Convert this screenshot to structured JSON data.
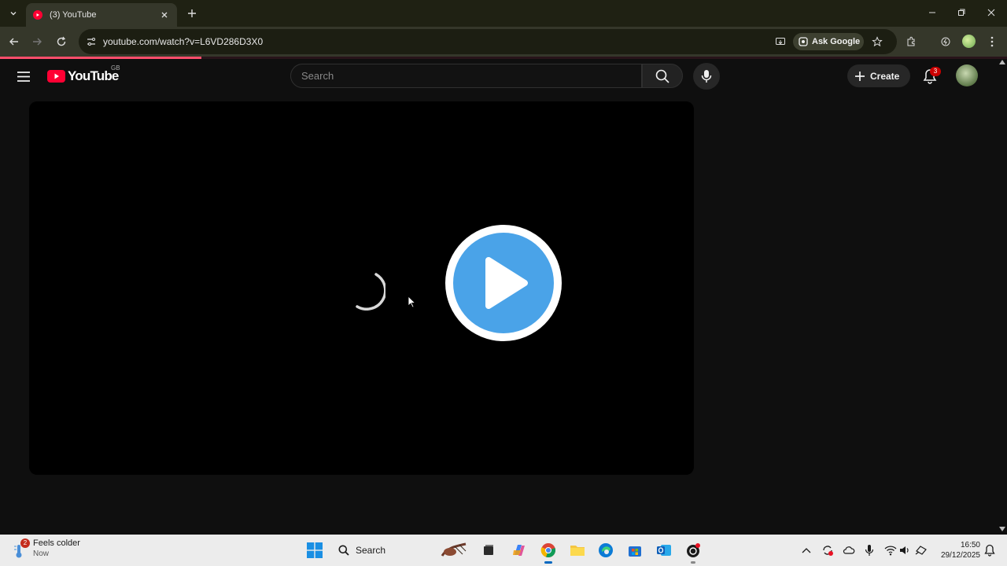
{
  "browser": {
    "tab": {
      "title": "(3) YouTube"
    },
    "url": "youtube.com/watch?v=L6VD286D3X0",
    "ask_google_label": "Ask Google",
    "load_progress": 0.2
  },
  "youtube": {
    "logo_text": "YouTube",
    "country_code": "GB",
    "search_placeholder": "Search",
    "create_label": "Create",
    "notification_count": "3",
    "brand_color": "#ff0033"
  },
  "player": {
    "state": "loading",
    "play_button_color": "#4aa3e8"
  },
  "taskbar": {
    "weather_title": "Feels colder",
    "weather_subtitle": "Now",
    "weather_badge": "2",
    "search_label": "Search",
    "time": "16:50",
    "date": "29/12/2025"
  }
}
